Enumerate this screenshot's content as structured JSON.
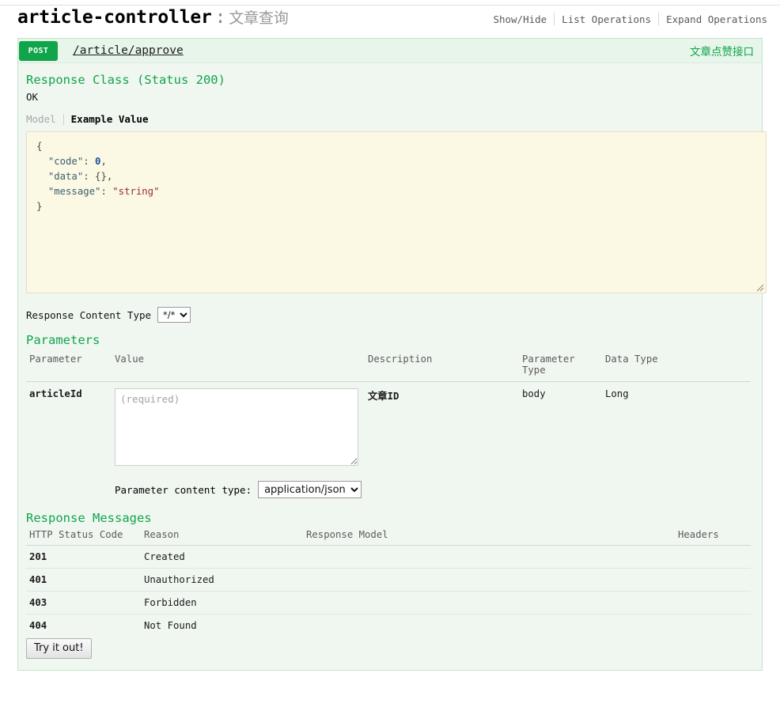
{
  "resource": {
    "name": "article-controller",
    "colon": ":",
    "description": "文章查询",
    "options": [
      {
        "label": "Show/Hide",
        "name": "show-hide"
      },
      {
        "label": "List Operations",
        "name": "list-operations"
      },
      {
        "label": "Expand Operations",
        "name": "expand-operations"
      }
    ]
  },
  "operation": {
    "method": "POST",
    "path": "/article/approve",
    "summary": "文章点赞接口",
    "response_class": {
      "heading": "Response Class (Status 200)",
      "status_text": "OK",
      "tabs": [
        {
          "label": "Model",
          "active": false
        },
        {
          "label": "Example Value",
          "active": true
        }
      ],
      "example_value": "{\n  \"code\": 0,\n  \"data\": {},\n  \"message\": \"string\"\n}",
      "example_tokens": [
        {
          "t": "{",
          "c": "punct"
        },
        {
          "t": "\n  ",
          "c": "punct"
        },
        {
          "t": "\"code\"",
          "c": "k"
        },
        {
          "t": ": ",
          "c": "punct"
        },
        {
          "t": "0",
          "c": "num"
        },
        {
          "t": ",\n  ",
          "c": "punct"
        },
        {
          "t": "\"data\"",
          "c": "k"
        },
        {
          "t": ": {},\n  ",
          "c": "punct"
        },
        {
          "t": "\"message\"",
          "c": "k"
        },
        {
          "t": ": ",
          "c": "punct"
        },
        {
          "t": "\"string\"",
          "c": "str"
        },
        {
          "t": "\n}",
          "c": "punct"
        }
      ]
    },
    "response_content_type": {
      "label": "Response Content Type",
      "selected": "*/*",
      "options": [
        "*/*"
      ]
    },
    "parameters_section": {
      "heading": "Parameters",
      "columns": [
        "Parameter",
        "Value",
        "Description",
        "Parameter Type",
        "Data Type"
      ],
      "rows": [
        {
          "parameter": "articleId",
          "value": "",
          "placeholder": "(required)",
          "description": "文章ID",
          "parameter_type": "body",
          "data_type": "Long"
        }
      ],
      "content_type": {
        "label": "Parameter content type:",
        "selected": "application/json",
        "options": [
          "application/json"
        ]
      }
    },
    "response_messages": {
      "heading": "Response Messages",
      "columns": [
        "HTTP Status Code",
        "Reason",
        "Response Model",
        "Headers"
      ],
      "rows": [
        {
          "code": "201",
          "reason": "Created",
          "model": "",
          "headers": ""
        },
        {
          "code": "401",
          "reason": "Unauthorized",
          "model": "",
          "headers": ""
        },
        {
          "code": "403",
          "reason": "Forbidden",
          "model": "",
          "headers": ""
        },
        {
          "code": "404",
          "reason": "Not Found",
          "model": "",
          "headers": ""
        }
      ]
    },
    "submit_label": "Try it out!"
  },
  "colors": {
    "method_post": "#10a54a",
    "accent_green": "#10a54a",
    "panel_bg": "#f0f7f1",
    "panel_border": "#c3e3c9",
    "example_bg": "#fbf8e3"
  }
}
